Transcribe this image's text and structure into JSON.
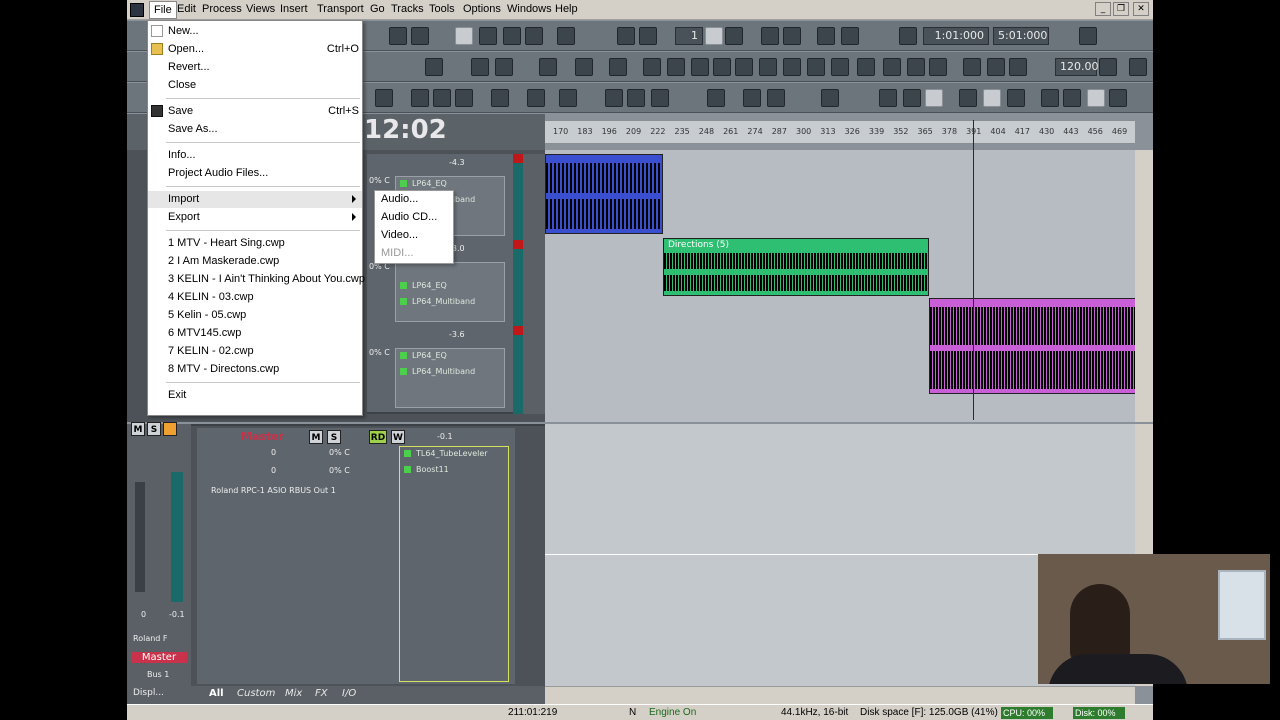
{
  "menubar": {
    "items": [
      "File",
      "Edit",
      "Process",
      "Views",
      "Insert",
      "Transport",
      "Go",
      "Tracks",
      "Tools",
      "Options",
      "Windows",
      "Help"
    ]
  },
  "transport": {
    "now_counter": "1",
    "loop_start": "1:01:000",
    "loop_end": "5:01:000",
    "tempo": "120.00",
    "clock": "12:02"
  },
  "ruler": {
    "ticks": [
      "170",
      "183",
      "196",
      "209",
      "222",
      "235",
      "248",
      "261",
      "274",
      "287",
      "300",
      "313",
      "326",
      "339",
      "352",
      "365",
      "378",
      "391",
      "404",
      "417",
      "430",
      "443",
      "456",
      "469"
    ]
  },
  "file_menu": {
    "new": "New...",
    "open": "Open...",
    "open_shortcut": "Ctrl+O",
    "revert": "Revert...",
    "close": "Close",
    "save": "Save",
    "save_shortcut": "Ctrl+S",
    "save_as": "Save As...",
    "info": "Info...",
    "project_audio": "Project Audio Files...",
    "import": "Import",
    "export": "Export",
    "recent": [
      "1 MTV - Heart Sing.cwp",
      "2 I Am Maskerade.cwp",
      "3 KELIN - I Ain't Thinking About You.cwp",
      "4 KELIN - 03.cwp",
      "5 Kelin - 05.cwp",
      "6 MTV145.cwp",
      "7 KELIN - 02.cwp",
      "8 MTV - Directons.cwp"
    ],
    "exit": "Exit"
  },
  "import_submenu": [
    "Audio...",
    "Audio CD...",
    "Video...",
    "MIDI..."
  ],
  "tracks": [
    {
      "vol": "-4.3",
      "pan": "0% C",
      "fx": [
        "LP64_EQ",
        "LP64_Multiband"
      ]
    },
    {
      "vol": "-3.0",
      "pan": "0% C",
      "fx": [
        "LP64_EQ",
        "LP64_Multiband"
      ]
    },
    {
      "vol": "-3.6",
      "pan": "0% C",
      "fx": [
        "LP64_EQ",
        "LP64_Multiband"
      ]
    }
  ],
  "clips": [
    {
      "label": "",
      "color": "#3a4fd0"
    },
    {
      "label": "Directions (5)",
      "color": "#2fbf73"
    },
    {
      "label": "",
      "color": "#c85fd6"
    }
  ],
  "master": {
    "name": "Master",
    "mute": "M",
    "solo": "S",
    "read": "RD",
    "write": "W",
    "vol": "-0.1",
    "send1_vol": "0",
    "send1_pan": "0% C",
    "send2_vol": "0",
    "send2_pan": "0% C",
    "output": "Roland RPC-1 ASIO RBUS Out 1",
    "fx": [
      "TL64_TubeLeveler",
      "Boost11"
    ],
    "fader_left": "0",
    "fader_right": "-0.1",
    "output_short": "Roland F",
    "bus_label": "Master",
    "bus_num": "Bus 1",
    "display": "Displ..."
  },
  "view_tabs": [
    "All",
    "Custom",
    "Mix",
    "FX",
    "I/O"
  ],
  "status": {
    "time": "211:01:219",
    "mode": "N",
    "engine": "Engine On",
    "format": "44.1kHz, 16-bit",
    "disk_space": "Disk space [F]: 125.0GB (41%)",
    "cpu": "CPU: 00%",
    "disk": "Disk: 00%"
  },
  "colors": {
    "clip_blue": "#3a4fd0",
    "clip_green": "#2fbf73",
    "clip_purple": "#c85fd6",
    "accent_red": "#c8324a"
  }
}
